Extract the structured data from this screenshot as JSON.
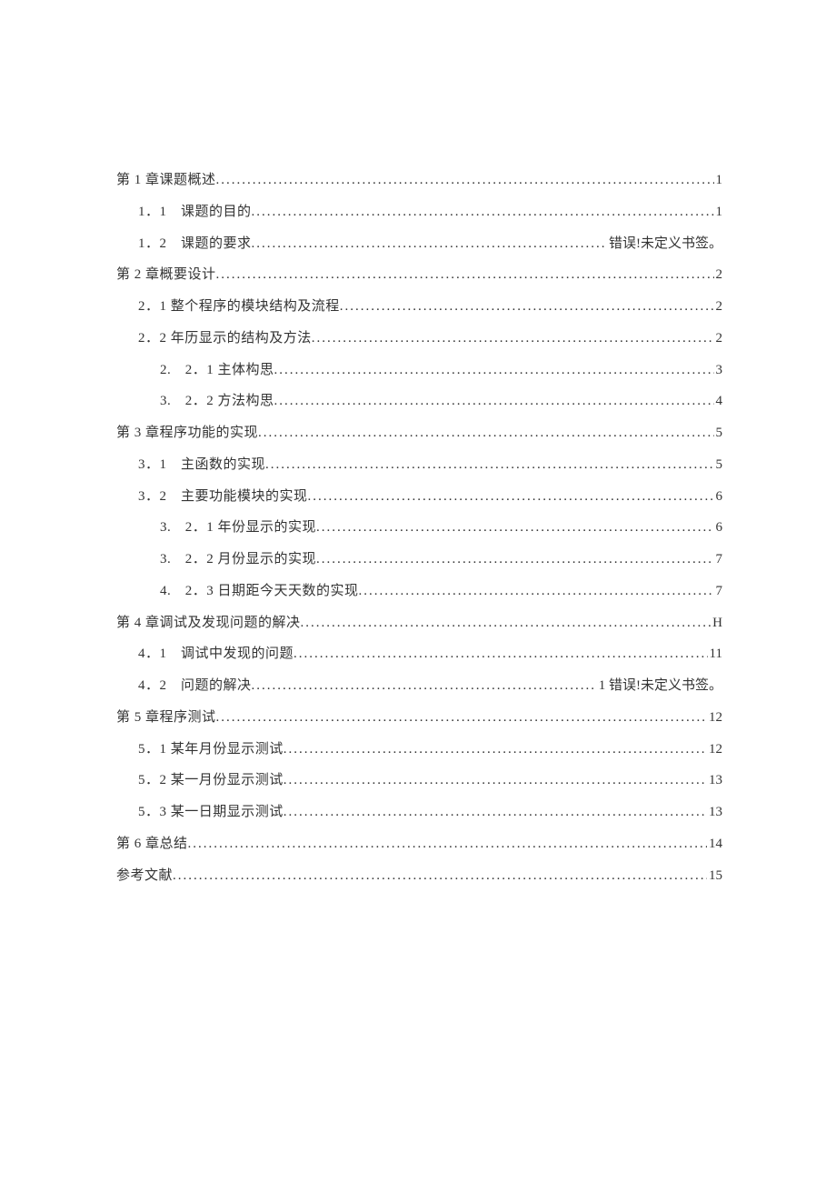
{
  "toc": [
    {
      "level": 0,
      "label": "第 1 章课题概述",
      "page": "1"
    },
    {
      "level": 1,
      "label": "1．1　课题的目的",
      "page": "1"
    },
    {
      "level": 1,
      "label": "1．2　课题的要求",
      "page": "错误!未定义书签。"
    },
    {
      "level": 0,
      "label": "第 2 章概要设计",
      "page": "2"
    },
    {
      "level": 1,
      "label": "2．1 整个程序的模块结构及流程",
      "page": "2"
    },
    {
      "level": 1,
      "label": "2．2 年历显示的结构及方法",
      "page": "2"
    },
    {
      "level": 2,
      "label": "2.　2．1 主体构思",
      "page": "3"
    },
    {
      "level": 2,
      "label": "3.　2．2 方法构思",
      "page": "4"
    },
    {
      "level": 0,
      "label": "第 3 章程序功能的实现",
      "page": "5"
    },
    {
      "level": 1,
      "label": "3．1　主函数的实现",
      "page": "5"
    },
    {
      "level": 1,
      "label": "3．2　主要功能模块的实现",
      "page": "6"
    },
    {
      "level": 2,
      "label": "3.　2．1 年份显示的实现",
      "page": "6"
    },
    {
      "level": 2,
      "label": "3.　2．2 月份显示的实现",
      "page": "7"
    },
    {
      "level": 2,
      "label": "4.　2．3 日期距今天天数的实现",
      "page": "7"
    },
    {
      "level": 0,
      "label": "第 4 章调试及发现问题的解决",
      "page": "H"
    },
    {
      "level": 1,
      "label": "4．1　调试中发现的问题 ",
      "page": "11"
    },
    {
      "level": 1,
      "label": "4．2　问题的解决",
      "page": "1 错误!未定义书签。"
    },
    {
      "level": 0,
      "label": "第 5 章程序测试 ",
      "page": "12"
    },
    {
      "level": 1,
      "label": "5．1 某年月份显示测试",
      "page": "12"
    },
    {
      "level": 1,
      "label": "5．2 某一月份显示测试",
      "page": "13"
    },
    {
      "level": 1,
      "label": "5．3 某一日期显示测试",
      "page": "13"
    },
    {
      "level": 0,
      "label": "第 6 章总结 ",
      "page": "14"
    },
    {
      "level": 0,
      "label": "参考文献",
      "page": "15"
    }
  ]
}
